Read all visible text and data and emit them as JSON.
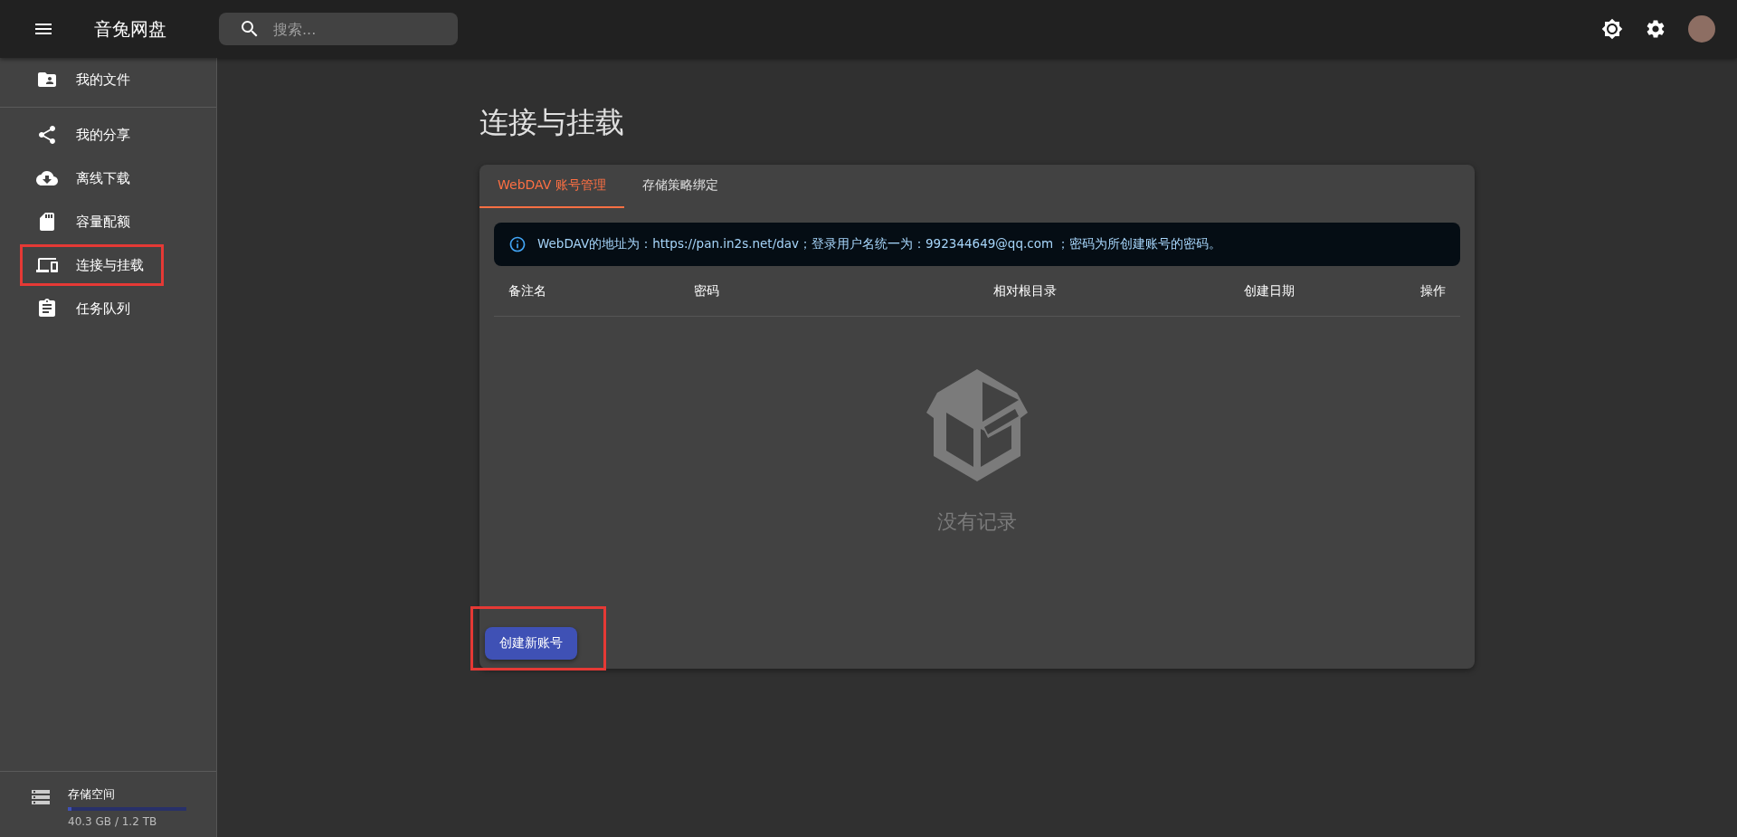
{
  "app_bar": {
    "title": "音兔网盘",
    "search": {
      "placeholder": "搜索..."
    }
  },
  "sidebar": {
    "items": [
      {
        "label": "我的文件",
        "kind": "folder",
        "highlighted": false
      },
      {
        "label": "我的分享",
        "kind": "share",
        "highlighted": false
      },
      {
        "label": "离线下载",
        "kind": "download",
        "highlighted": false
      },
      {
        "label": "容量配额",
        "kind": "card",
        "highlighted": false
      },
      {
        "label": "连接与挂载",
        "kind": "devices",
        "highlighted": true
      },
      {
        "label": "任务队列",
        "kind": "clipboard",
        "highlighted": false
      }
    ],
    "storage": {
      "label": "存储空间",
      "level": 0.03,
      "reading": "40.3 GB / 1.2 TB"
    }
  },
  "page": {
    "title": "连接与挂载",
    "tabs": [
      {
        "label": "WebDAV 账号管理",
        "selected": true
      },
      {
        "label": "存储策略绑定",
        "selected": false
      }
    ],
    "info": "WebDAV的地址为：https://pan.in2s.net/dav；登录用户名统一为：992344649@qq.com ；密码为所创建账号的密码。",
    "table": {
      "columns": [
        "备注名",
        "密码",
        "相对根目录",
        "创建日期",
        "操作"
      ]
    },
    "empty_text": "没有记录",
    "create_button": {
      "label": "创建新账号",
      "highlighted": true
    }
  }
}
